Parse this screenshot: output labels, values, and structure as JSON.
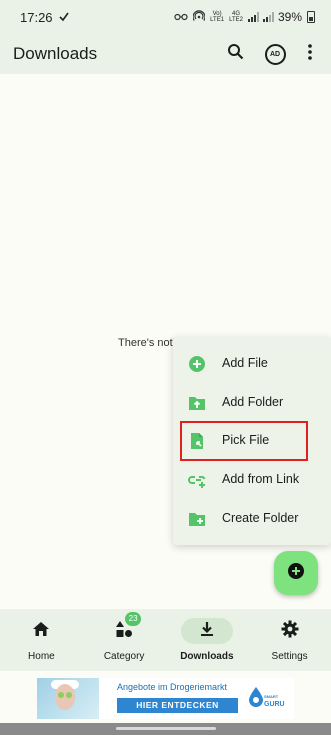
{
  "status_bar": {
    "time": "17:26",
    "network_top": "Vo)",
    "network_bottom": "LTE1",
    "network_4g_top": "4G",
    "network_4g_bottom": "LTE2",
    "battery": "39%"
  },
  "top_bar": {
    "title": "Downloads",
    "ad_icon_label": "AD"
  },
  "empty_state": {
    "text": "There's noth"
  },
  "fab_menu": {
    "items": [
      {
        "label": "Add File",
        "icon": "plus-circle-icon"
      },
      {
        "label": "Add Folder",
        "icon": "folder-upload-icon"
      },
      {
        "label": "Pick File",
        "icon": "file-pick-icon"
      },
      {
        "label": "Add from Link",
        "icon": "link-add-icon"
      },
      {
        "label": "Create Folder",
        "icon": "folder-plus-icon"
      }
    ],
    "highlighted_item": "Pick File"
  },
  "bottom_nav": {
    "items": [
      {
        "label": "Home",
        "icon": "home-icon"
      },
      {
        "label": "Category",
        "icon": "category-icon",
        "badge": "23"
      },
      {
        "label": "Downloads",
        "icon": "download-icon",
        "active": true
      },
      {
        "label": "Settings",
        "icon": "gear-icon"
      }
    ]
  },
  "ad": {
    "headline": "Angebote im Drogeriemarkt",
    "cta": "HIER ENTDECKEN",
    "logo_small": "SMART",
    "logo_big": "GURU"
  },
  "colors": {
    "accent_green": "#54c468",
    "fab_green": "#7ee27f",
    "highlight_red": "#e12020",
    "bar_background": "#eaf1e6"
  }
}
